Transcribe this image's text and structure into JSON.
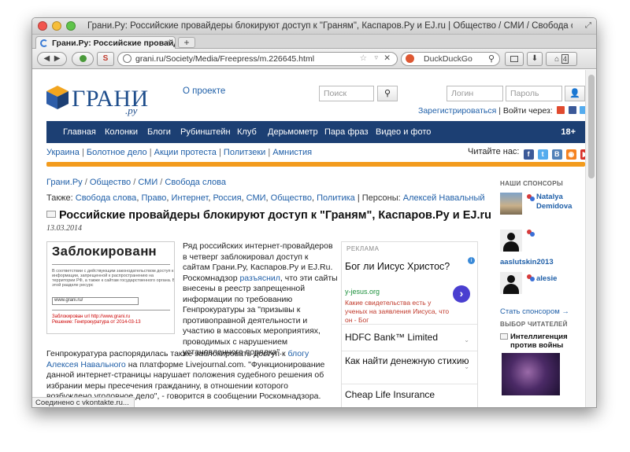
{
  "window": {
    "title": "Грани.Ру: Российские провайдеры блокируют доступ к \"Граням\", Каспаров.Ру и EJ.ru | Общество / СМИ / Свобода слова"
  },
  "tab": {
    "label": "Грани.Ру: Российские провайд...",
    "close": "×",
    "new_tab": "+"
  },
  "navbar": {
    "url": "grani.ru/Society/Media/Freepress/m.226645.html",
    "search_engine": "DuckDuckGo",
    "back": "◀",
    "forward": "▶",
    "clear": "✕",
    "star": "☆",
    "dropdown": "▿",
    "search_icon": "⚲",
    "page_count": "4"
  },
  "site": {
    "logo_text": "ГРАНИ",
    "logo_suffix": ".ру",
    "about": "О проекте",
    "search_placeholder": "Поиск",
    "login_placeholder": "Логин",
    "password_placeholder": "Пароль",
    "search_btn": "⚲",
    "login_btn": "👤",
    "register": "Зарегистрироваться",
    "login_via": "Войти через:",
    "nav": [
      "Главная",
      "Колонки",
      "Блоги",
      "Рубинштейн",
      "Клуб",
      "Дерьмометр",
      "Пара фраз",
      "Видео и фото"
    ],
    "age": "18+",
    "subnav": [
      "Украина",
      "Болотное дело",
      "Акции протеста",
      "Политзеки",
      "Амнистия"
    ],
    "read_us": "Читайте нас:"
  },
  "article": {
    "breadcrumb": [
      "Грани.Ру",
      "Общество",
      "СМИ",
      "Свобода слова"
    ],
    "tags_prefix": "Также:",
    "tags": [
      "Свобода слова",
      "Право",
      "Интернет",
      "Россия",
      "СМИ",
      "Общество",
      "Политика"
    ],
    "persons_prefix": "| Персоны:",
    "person": "Алексей Навальный",
    "headline": "Российские провайдеры блокируют доступ к \"Граням\", Каспаров.Ру и EJ.ru",
    "date": "13.03.2014",
    "image": {
      "title": "Заблокированн",
      "small_text": "В соответствии с действующим законодательством доступ к информации, запрещенной к распространению на территории РФ, а также к сайтам государственного органа. В этой разделе ресурс",
      "url": "www.grani.ru/",
      "red_line1": "Заблокирован url http://www.grani.ru",
      "red_line2": "Решение: Генпрокуратура от 2014-03-13"
    },
    "lead_before": "Ряд российских интернет-провайдеров в четверг заблокировал доступ к сайтам Грани.Ру, Каспаров.Ру и EJ.Ru. Роскомнадзор ",
    "lead_link": "разъяснил",
    "lead_after": ", что эти сайты внесены в реестр запрещенной информации по требованию Генпрокуратуры за \"призывы к противоправной деятельности и участию в массовых мероприятиях, проводимых с нарушением установленного порядка\".",
    "body_before": "Генпрокуратура распорядилась также заблокировать доступ к ",
    "body_link": "блогу Алексея Навального",
    "body_after": " на платформе Livejournal.com. \"Функционирование данной интернет-страницы нарушает положения судебного решения об избрании меры пресечения гражданину, в отношении которого возбуждено уголовное дело\", - говорится в сообщении Роскомнадзора."
  },
  "ads": {
    "label": "РЕКЛАМА",
    "info": "i",
    "ad1": {
      "title": "Бог ли Иисус Христос?",
      "url": "y-jesus.org",
      "desc": "Какие свидетельства есть у ученых на заявления Иисуса, что он - Бог",
      "arrow": "›"
    },
    "rows": [
      "HDFC Bank™ Limited",
      "Как найти денежную стихию",
      "Cheap Life Insurance"
    ],
    "caret": "⌄"
  },
  "sidebar": {
    "sponsors_heading": "НАШИ СПОНСОРЫ",
    "sponsors": [
      "Natalya Demidova",
      "aaslutskin2013",
      "alesie"
    ],
    "become_sponsor": "Стать спонсором →",
    "readers_choice": "ВЫБОР ЧИТАТЕЛЕЙ",
    "choice_title": "Интеллигенция против войны"
  },
  "status": {
    "text": "Соединено с vkontakte.ru..."
  },
  "colors": {
    "nav_bg": "#1c3f73",
    "accent_bar": "#f39b1d",
    "link": "#1f5fa8"
  }
}
